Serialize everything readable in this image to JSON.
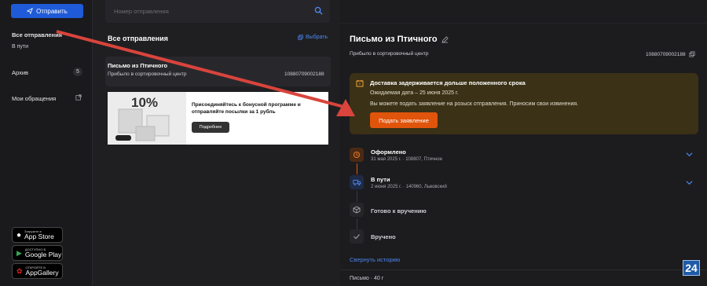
{
  "sidebar": {
    "send_label": "Отправить",
    "all_label": "Все отправления",
    "in_transit_label": "В пути",
    "archive_label": "Архив",
    "archive_count": "5",
    "appeals_label": "Мои обращения",
    "stores": [
      {
        "small": "Загрузите в",
        "big": "App Store"
      },
      {
        "small": "ДОСТУПНО В",
        "big": "Google Play"
      },
      {
        "small": "ОТКРОЙТЕ В",
        "big": "AppGallery"
      }
    ]
  },
  "middle": {
    "search_placeholder": "Номер отправления",
    "list_title": "Все отправления",
    "select_label": "Выбрать",
    "card": {
      "title": "Письмо из Птичного",
      "status": "Прибыло в сортировочный центр",
      "track": "10880709002188"
    },
    "banner": {
      "percent": "10%",
      "text": "Присоединяйтесь к бонусной программе и отправляйте посылки за 1 рубль",
      "button": "Подробнее"
    }
  },
  "detail": {
    "title": "Письмо из Птичного",
    "status": "Прибыло в сортировочный центр",
    "track": "10880709002188",
    "alert": {
      "title": "Доставка задерживается дольше положенного срока",
      "expected": "Ожидаемая дата – 25 июня 2025 г.",
      "body": "Вы можете подать заявление на розыск отправления. Приносим свои извинения.",
      "button": "Подать заявление"
    },
    "steps": [
      {
        "title": "Оформлено",
        "meta": "31 мая 2025 г. · 108807, Птичное"
      },
      {
        "title": "В пути",
        "meta": "2 июня 2025 г. · 140960, Львовский"
      },
      {
        "title": "Готово к вручению",
        "meta": ""
      },
      {
        "title": "Вручено",
        "meta": ""
      }
    ],
    "collapse_label": "Свернуть историю",
    "weight": "Письмо · 40 г"
  },
  "watermark": "24",
  "colors": {
    "accent": "#1f5bd8",
    "link": "#4d86f0",
    "orange": "#e0540b",
    "alert_bg": "#3b3116",
    "arrow": "#d9443c"
  }
}
